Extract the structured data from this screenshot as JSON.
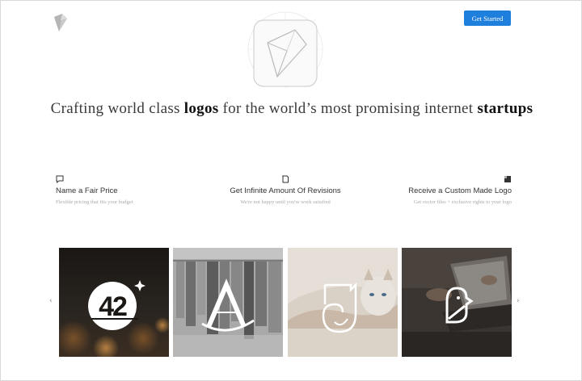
{
  "header": {
    "logo_icon": "folded-leaf-logo-icon",
    "cta_label": "Get Started",
    "cta_color": "#1e7fdc"
  },
  "hero": {
    "headline_pre_1": "Crafting world class ",
    "headline_em_1": "logos",
    "headline_mid": " for the world’s most promising internet ",
    "headline_em_2": "startups"
  },
  "features": [
    {
      "icon": "chat-bubble-icon",
      "title": "Name a Fair Price",
      "description": "Flexible pricing that fits your budget"
    },
    {
      "icon": "document-icon",
      "title": "Get Infinite Amount Of Revisions",
      "description": "We're not happy until you're work satisfied"
    },
    {
      "icon": "badge-icon",
      "title": "Receive a Custom Made Logo",
      "description": "Get vector files + exclusive rights to your logo"
    }
  ],
  "carousel": {
    "prev_glyph": "‹",
    "next_glyph": "›",
    "tiles": [
      {
        "logo": "42-logo",
        "logo_text": "42",
        "background": "dark-bokeh"
      },
      {
        "logo": "letter-a-logo",
        "logo_text": "A",
        "background": "clothing-rack"
      },
      {
        "logo": "cat-outline-logo",
        "background": "person-holding-cat"
      },
      {
        "logo": "bird-logo",
        "background": "laptop-desk"
      }
    ]
  }
}
